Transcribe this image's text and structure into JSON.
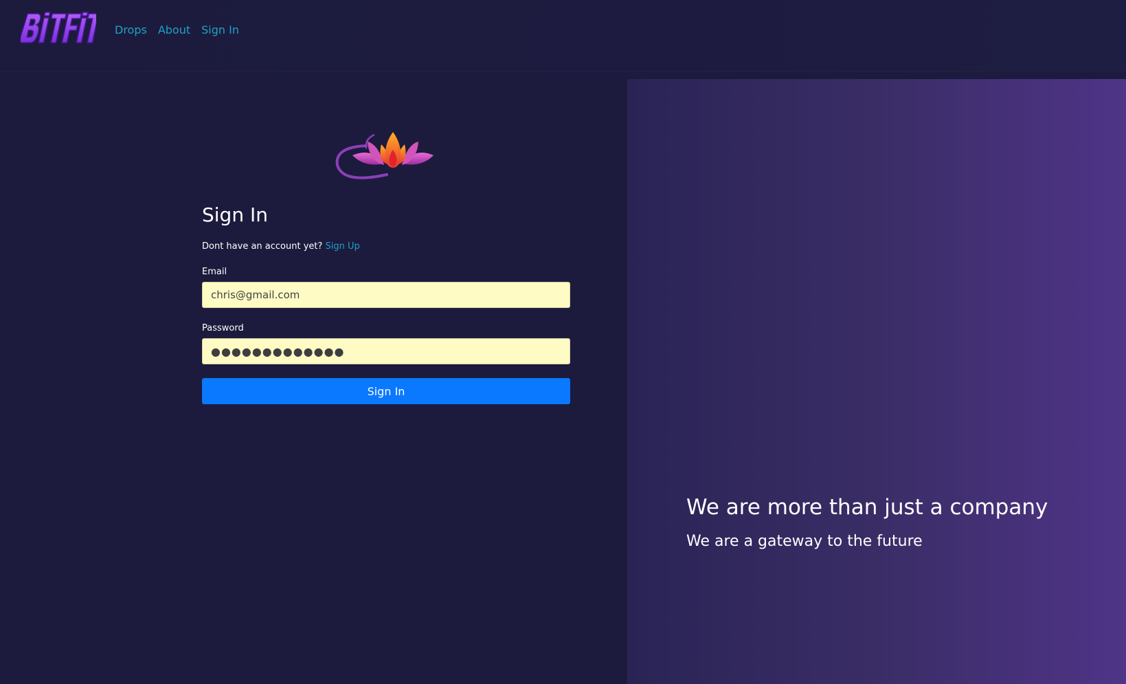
{
  "nav": {
    "brand": "BITFIT",
    "links": [
      "Drops",
      "About",
      "Sign In"
    ]
  },
  "form": {
    "title": "Sign In",
    "signup_prompt": "Dont have an account yet?",
    "signup_link": "Sign Up",
    "email_label": "Email",
    "email_value": "chris@gmail.com",
    "password_label": "Password",
    "password_value": "●●●●●●●●●●●●●",
    "submit_label": "Sign In"
  },
  "hero": {
    "headline": "We are more than just a company",
    "subline": "We are a gateway to the future"
  },
  "colors": {
    "background": "#1c1b3d",
    "nav_link": "#1fa2c2",
    "input_bg": "#fffbc4",
    "button": "#0a78ff",
    "panel_gradient_start": "#2a2455",
    "panel_gradient_end": "#4f3487"
  },
  "icons": {
    "brand": "bitfit-logo",
    "form_logo": "lotus-logo-icon"
  }
}
